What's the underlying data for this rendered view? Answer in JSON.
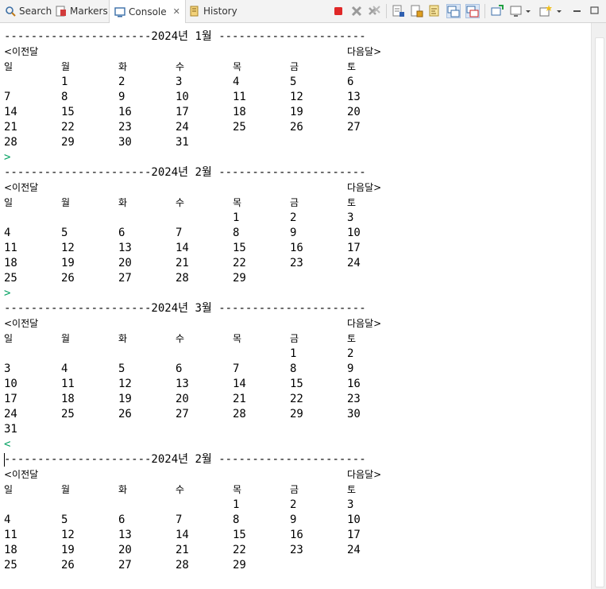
{
  "tabs": [
    {
      "label": "Search",
      "icon": "search-icon",
      "active": false
    },
    {
      "label": "Markers",
      "icon": "markers-icon",
      "active": false
    },
    {
      "label": "Console",
      "icon": "console-icon",
      "active": true
    },
    {
      "label": "History",
      "icon": "history-icon",
      "active": false
    }
  ],
  "toolbar_icons": [
    "terminate-icon",
    "remove-launch-icon",
    "remove-all-terminated-icon",
    "clear-console-icon",
    "scroll-lock-icon",
    "word-wrap-icon",
    "show-on-stdout-icon",
    "show-on-stderr-icon",
    "pin-console-icon",
    "display-console-icon",
    "dropdown-arrow-icon",
    "open-console-icon",
    "dropdown-arrow-icon",
    "minimize-icon",
    "maximize-icon"
  ],
  "months": [
    {
      "header": "----------------------2024년 1월 ----------------------",
      "prev": "<이전달",
      "next": "다음달>",
      "weekdays": [
        "일",
        "월",
        "화",
        "수",
        "목",
        "금",
        "토"
      ],
      "weeks": [
        [
          "",
          "1",
          "2",
          "3",
          "4",
          "5",
          "6"
        ],
        [
          "7",
          "8",
          "9",
          "10",
          "11",
          "12",
          "13"
        ],
        [
          "14",
          "15",
          "16",
          "17",
          "18",
          "19",
          "20"
        ],
        [
          "21",
          "22",
          "23",
          "24",
          "25",
          "26",
          "27"
        ],
        [
          "28",
          "29",
          "30",
          "31",
          "",
          "",
          ""
        ]
      ],
      "input": ">"
    },
    {
      "header": "----------------------2024년 2월 ----------------------",
      "prev": "<이전달",
      "next": "다음달>",
      "weekdays": [
        "일",
        "월",
        "화",
        "수",
        "목",
        "금",
        "토"
      ],
      "weeks": [
        [
          "",
          "",
          "",
          "",
          "1",
          "2",
          "3"
        ],
        [
          "4",
          "5",
          "6",
          "7",
          "8",
          "9",
          "10"
        ],
        [
          "11",
          "12",
          "13",
          "14",
          "15",
          "16",
          "17"
        ],
        [
          "18",
          "19",
          "20",
          "21",
          "22",
          "23",
          "24"
        ],
        [
          "25",
          "26",
          "27",
          "28",
          "29",
          "",
          ""
        ]
      ],
      "input": ">"
    },
    {
      "header": "----------------------2024년 3월 ----------------------",
      "prev": "<이전달",
      "next": "다음달>",
      "weekdays": [
        "일",
        "월",
        "화",
        "수",
        "목",
        "금",
        "토"
      ],
      "weeks": [
        [
          "",
          "",
          "",
          "",
          "",
          "1",
          "2"
        ],
        [
          "3",
          "4",
          "5",
          "6",
          "7",
          "8",
          "9"
        ],
        [
          "10",
          "11",
          "12",
          "13",
          "14",
          "15",
          "16"
        ],
        [
          "17",
          "18",
          "19",
          "20",
          "21",
          "22",
          "23"
        ],
        [
          "24",
          "25",
          "26",
          "27",
          "28",
          "29",
          "30"
        ],
        [
          "31",
          "",
          "",
          "",
          "",
          "",
          ""
        ]
      ],
      "input": "<"
    },
    {
      "header": "----------------------2024년 2월 ----------------------",
      "prev": "<이전달",
      "next": "다음달>",
      "weekdays": [
        "일",
        "월",
        "화",
        "수",
        "목",
        "금",
        "토"
      ],
      "weeks": [
        [
          "",
          "",
          "",
          "",
          "1",
          "2",
          "3"
        ],
        [
          "4",
          "5",
          "6",
          "7",
          "8",
          "9",
          "10"
        ],
        [
          "11",
          "12",
          "13",
          "14",
          "15",
          "16",
          "17"
        ],
        [
          "18",
          "19",
          "20",
          "21",
          "22",
          "23",
          "24"
        ],
        [
          "25",
          "26",
          "27",
          "28",
          "29",
          "",
          ""
        ]
      ],
      "input": null
    }
  ]
}
